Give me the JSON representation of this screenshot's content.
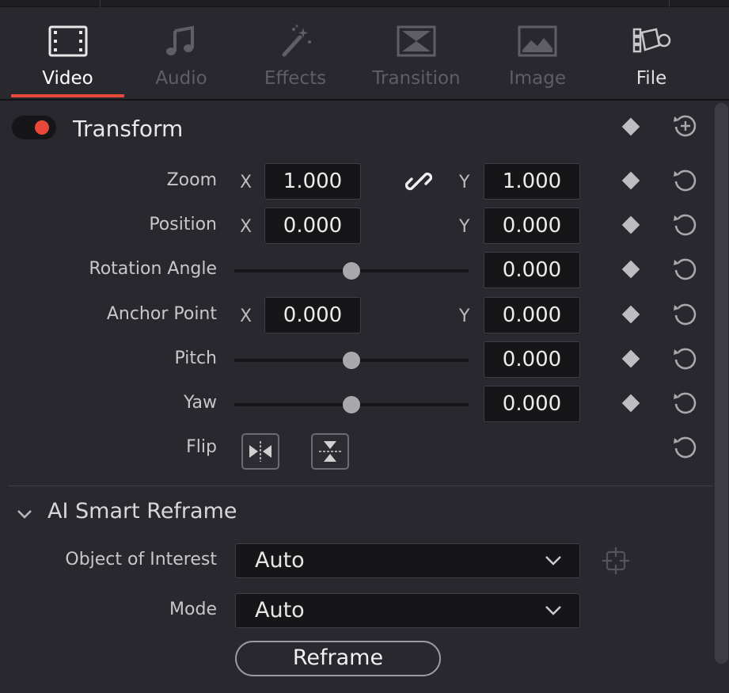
{
  "tabs": [
    {
      "id": "video",
      "label": "Video",
      "icon": "film-strip-icon",
      "state": "active"
    },
    {
      "id": "audio",
      "label": "Audio",
      "icon": "music-note-icon",
      "state": "dim"
    },
    {
      "id": "effects",
      "label": "Effects",
      "icon": "magic-wand-icon",
      "state": "dim"
    },
    {
      "id": "transition",
      "label": "Transition",
      "icon": "transition-icon",
      "state": "dim"
    },
    {
      "id": "image",
      "label": "Image",
      "icon": "image-icon",
      "state": "dim"
    },
    {
      "id": "file",
      "label": "File",
      "icon": "camera-file-icon",
      "state": "normal"
    }
  ],
  "accent_color": "#e5493a",
  "transform": {
    "title": "Transform",
    "enabled": true,
    "zoom": {
      "label": "Zoom",
      "x_axis": "X",
      "x": "1.000",
      "y_axis": "Y",
      "y": "1.000",
      "linked": true
    },
    "position": {
      "label": "Position",
      "x_axis": "X",
      "x": "0.000",
      "y_axis": "Y",
      "y": "0.000"
    },
    "rotation": {
      "label": "Rotation Angle",
      "value": "0.000",
      "slider_level": 0.5
    },
    "anchor": {
      "label": "Anchor Point",
      "x_axis": "X",
      "x": "0.000",
      "y_axis": "Y",
      "y": "0.000"
    },
    "pitch": {
      "label": "Pitch",
      "value": "0.000",
      "slider_level": 0.5
    },
    "yaw": {
      "label": "Yaw",
      "value": "0.000",
      "slider_level": 0.5
    },
    "flip": {
      "label": "Flip"
    }
  },
  "smart_reframe": {
    "title": "AI Smart Reframe",
    "object_label": "Object of Interest",
    "object_value": "Auto",
    "mode_label": "Mode",
    "mode_value": "Auto",
    "reframe_button": "Reframe"
  }
}
